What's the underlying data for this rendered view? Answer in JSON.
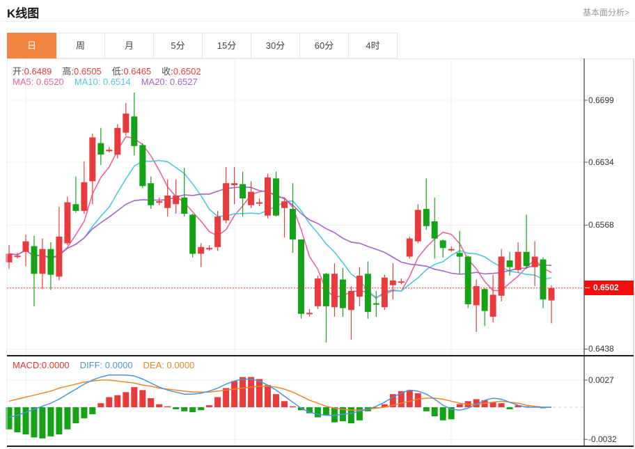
{
  "header": {
    "title": "K线图",
    "link": "基本面分析>"
  },
  "tabs": {
    "items": [
      "日",
      "周",
      "月",
      "5分",
      "15分",
      "30分",
      "60分",
      "4时"
    ],
    "active_index": 0
  },
  "overlay": {
    "ohlc": {
      "open_label": "开:",
      "open": "0.6489",
      "high_label": "高:",
      "high": "0.6505",
      "low_label": "低:",
      "low": "0.6465",
      "close_label": "收:",
      "close": "0.6502"
    },
    "ma": {
      "ma5_label": "MA5:",
      "ma5": "0.6520",
      "ma10_label": "MA10:",
      "ma10": "0.6514",
      "ma20_label": "MA20:",
      "ma20": "0.6527"
    },
    "macd": {
      "macd_label": "MACD:",
      "macd": "0.0000",
      "diff_label": "DIFF:",
      "diff": "0.0000",
      "dea_label": "DEA:",
      "dea": "0.0000"
    }
  },
  "axis": {
    "price_ticks": [
      "0.6699",
      "0.6634",
      "0.6568",
      "0.6438"
    ],
    "current_price": "0.6502",
    "macd_ticks": [
      "0.0027",
      "-0.0032"
    ]
  },
  "colors": {
    "up": "#e83b3d",
    "down": "#16a216",
    "ma5": "#f0619e",
    "ma10": "#4cc8de",
    "ma20": "#a663c8",
    "diff": "#4a95dd",
    "dea": "#f08528",
    "accent": "#f08440",
    "price_line": "#fd2b2b",
    "badge": "#f50d0d",
    "grid": "#e9eef5",
    "axis_line": "#3a3a3a"
  },
  "chart_data": {
    "type": "candlestick+macd",
    "title": "K线图",
    "legend": [
      "MA5",
      "MA10",
      "MA20",
      "MACD",
      "DIFF",
      "DEA"
    ],
    "price_axis": {
      "ticks": [
        0.6699,
        0.6634,
        0.6568,
        0.6438
      ],
      "current": 0.6502,
      "range": [
        0.6438,
        0.671
      ]
    },
    "macd_axis": {
      "ticks": [
        0.0027,
        -0.0032
      ],
      "zero": 0.0
    },
    "ma_windows": [
      5,
      10,
      20
    ],
    "candles": [
      [
        0.6529,
        0.6547,
        0.6522,
        0.6538
      ],
      [
        0.6536,
        0.6539,
        0.6533,
        0.6536
      ],
      [
        0.654,
        0.6558,
        0.6525,
        0.6551
      ],
      [
        0.6546,
        0.6557,
        0.6483,
        0.6517
      ],
      [
        0.6517,
        0.6554,
        0.6501,
        0.6543
      ],
      [
        0.6543,
        0.655,
        0.65,
        0.6516
      ],
      [
        0.6514,
        0.6587,
        0.651,
        0.6556
      ],
      [
        0.6549,
        0.6598,
        0.6547,
        0.6592
      ],
      [
        0.659,
        0.6619,
        0.6581,
        0.6583
      ],
      [
        0.6583,
        0.6635,
        0.658,
        0.6613
      ],
      [
        0.6614,
        0.6664,
        0.659,
        0.666
      ],
      [
        0.6654,
        0.667,
        0.6631,
        0.6642
      ],
      [
        0.6647,
        0.665,
        0.6644,
        0.6647
      ],
      [
        0.6642,
        0.6674,
        0.6638,
        0.667
      ],
      [
        0.6665,
        0.6696,
        0.6662,
        0.6685
      ],
      [
        0.6682,
        0.6707,
        0.6641,
        0.6651
      ],
      [
        0.6652,
        0.6654,
        0.6607,
        0.6609
      ],
      [
        0.6612,
        0.6619,
        0.6585,
        0.6589
      ],
      [
        0.6593,
        0.6597,
        0.6589,
        0.6593
      ],
      [
        0.6586,
        0.6616,
        0.6577,
        0.6599
      ],
      [
        0.659,
        0.6616,
        0.658,
        0.6599
      ],
      [
        0.6597,
        0.6628,
        0.6577,
        0.658
      ],
      [
        0.6579,
        0.658,
        0.6534,
        0.6538
      ],
      [
        0.6538,
        0.6549,
        0.6524,
        0.6545
      ],
      [
        0.6544,
        0.6547,
        0.6541,
        0.6544
      ],
      [
        0.6545,
        0.6583,
        0.6541,
        0.6577
      ],
      [
        0.6573,
        0.6629,
        0.657,
        0.6612
      ],
      [
        0.661,
        0.6629,
        0.659,
        0.6612
      ],
      [
        0.6611,
        0.6624,
        0.6577,
        0.6596
      ],
      [
        0.6589,
        0.6614,
        0.6586,
        0.6603
      ],
      [
        0.6592,
        0.6596,
        0.6588,
        0.6592
      ],
      [
        0.6578,
        0.6622,
        0.6575,
        0.6618
      ],
      [
        0.6617,
        0.6624,
        0.6577,
        0.6578
      ],
      [
        0.6586,
        0.6596,
        0.6555,
        0.6593
      ],
      [
        0.6585,
        0.6612,
        0.6539,
        0.6553
      ],
      [
        0.6553,
        0.6553,
        0.647,
        0.6475
      ],
      [
        0.6476,
        0.648,
        0.6472,
        0.6476
      ],
      [
        0.6483,
        0.6515,
        0.648,
        0.6512
      ],
      [
        0.6517,
        0.6518,
        0.6445,
        0.6483
      ],
      [
        0.6482,
        0.6528,
        0.6472,
        0.6517
      ],
      [
        0.6511,
        0.6523,
        0.6472,
        0.6481
      ],
      [
        0.6479,
        0.6504,
        0.6448,
        0.6499
      ],
      [
        0.6493,
        0.6524,
        0.6483,
        0.6515
      ],
      [
        0.6517,
        0.653,
        0.647,
        0.6477
      ],
      [
        0.6486,
        0.6499,
        0.6472,
        0.6485
      ],
      [
        0.6482,
        0.6516,
        0.6479,
        0.6513
      ],
      [
        0.6505,
        0.6528,
        0.649,
        0.651
      ],
      [
        0.6509,
        0.6512,
        0.6506,
        0.6509
      ],
      [
        0.6535,
        0.6556,
        0.6533,
        0.6554
      ],
      [
        0.6551,
        0.659,
        0.6549,
        0.6584
      ],
      [
        0.6585,
        0.6617,
        0.6563,
        0.6567
      ],
      [
        0.6572,
        0.6597,
        0.6533,
        0.6554
      ],
      [
        0.6552,
        0.6553,
        0.6534,
        0.6544
      ],
      [
        0.6543,
        0.6546,
        0.654,
        0.6543
      ],
      [
        0.6539,
        0.6562,
        0.6517,
        0.6535
      ],
      [
        0.6535,
        0.6536,
        0.6481,
        0.6485
      ],
      [
        0.6484,
        0.6511,
        0.6456,
        0.6504
      ],
      [
        0.6501,
        0.6502,
        0.6462,
        0.6478
      ],
      [
        0.6472,
        0.6516,
        0.6466,
        0.6495
      ],
      [
        0.6494,
        0.6543,
        0.6488,
        0.6535
      ],
      [
        0.6531,
        0.654,
        0.6515,
        0.6524
      ],
      [
        0.6521,
        0.655,
        0.6518,
        0.654
      ],
      [
        0.654,
        0.6579,
        0.6522,
        0.6525
      ],
      [
        0.6524,
        0.6551,
        0.6504,
        0.6535
      ],
      [
        0.6532,
        0.6534,
        0.6481,
        0.649
      ],
      [
        0.6489,
        0.6505,
        0.6465,
        0.6502
      ]
    ],
    "macd": {
      "hist": [
        -0.0022,
        -0.0025,
        -0.0027,
        -0.003,
        -0.0031,
        -0.0029,
        -0.0027,
        -0.0022,
        -0.0016,
        -0.0011,
        -0.0007,
        0.0004,
        0.001,
        0.0012,
        0.0015,
        0.002,
        0.0017,
        0.0009,
        0.0003,
        0.0001,
        -0.0002,
        -0.0004,
        -0.0005,
        -0.0003,
        0.0002,
        0.001,
        0.0019,
        0.0026,
        0.003,
        0.003,
        0.0028,
        0.0022,
        0.0013,
        0.0006,
        0.0001,
        -0.0003,
        -0.0006,
        -0.001,
        -0.0008,
        -0.0015,
        -0.0014,
        -0.0016,
        -0.0013,
        -0.0004,
        -0.0001,
        0.0003,
        0.0013,
        0.0016,
        0.0017,
        0.0014,
        -0.0004,
        -0.0009,
        -0.0013,
        -0.0012,
        0.0003,
        0.0006,
        0.0008,
        0.0007,
        0.0005,
        0.0004,
        -0.0002,
        0.0002,
        0.0001,
        0.0001,
        -0.0001,
        0.0
      ],
      "diff": [
        -0.001,
        -0.0008,
        -0.0005,
        -0.0002,
        0.0001,
        0.0004,
        0.0008,
        0.0013,
        0.0018,
        0.0023,
        0.0027,
        0.003,
        0.0032,
        0.0032,
        0.0032,
        0.0031,
        0.0028,
        0.0024,
        0.002,
        0.0017,
        0.0015,
        0.0013,
        0.0013,
        0.0014,
        0.0016,
        0.0019,
        0.0023,
        0.0026,
        0.0028,
        0.0028,
        0.0026,
        0.0022,
        0.0017,
        0.0011,
        0.0005,
        -0.0001,
        -0.0005,
        -0.0007,
        -0.0008,
        -0.0008,
        -0.0007,
        -0.0006,
        -0.0004,
        -0.0002,
        0.0001,
        0.0005,
        0.001,
        0.0014,
        0.0017,
        0.0016,
        0.0013,
        0.0008,
        0.0002,
        -0.0002,
        -0.0003,
        -0.0001,
        0.0003,
        0.0007,
        0.0009,
        0.0008,
        0.0005,
        0.0002,
        0.0,
        0.0,
        0.0,
        0.0
      ],
      "dea": [
        0.0006,
        0.0008,
        0.001,
        0.0012,
        0.0014,
        0.0016,
        0.0019,
        0.0021,
        0.0023,
        0.0025,
        0.0026,
        0.0027,
        0.0027,
        0.0026,
        0.0025,
        0.0024,
        0.0022,
        0.0021,
        0.0019,
        0.0018,
        0.0017,
        0.0016,
        0.0015,
        0.0015,
        0.0015,
        0.0016,
        0.0017,
        0.0018,
        0.0019,
        0.002,
        0.0021,
        0.0021,
        0.002,
        0.0018,
        0.0015,
        0.0011,
        0.0007,
        0.0004,
        0.0001,
        -0.0001,
        -0.0002,
        -0.0003,
        -0.0003,
        -0.0002,
        -0.0001,
        0.0,
        0.0002,
        0.0004,
        0.0006,
        0.0008,
        0.0009,
        0.0009,
        0.0008,
        0.0006,
        0.0004,
        0.0003,
        0.0003,
        0.0004,
        0.0005,
        0.0006,
        0.0005,
        0.0004,
        0.0002,
        0.0001,
        0.0,
        0.0
      ]
    }
  }
}
